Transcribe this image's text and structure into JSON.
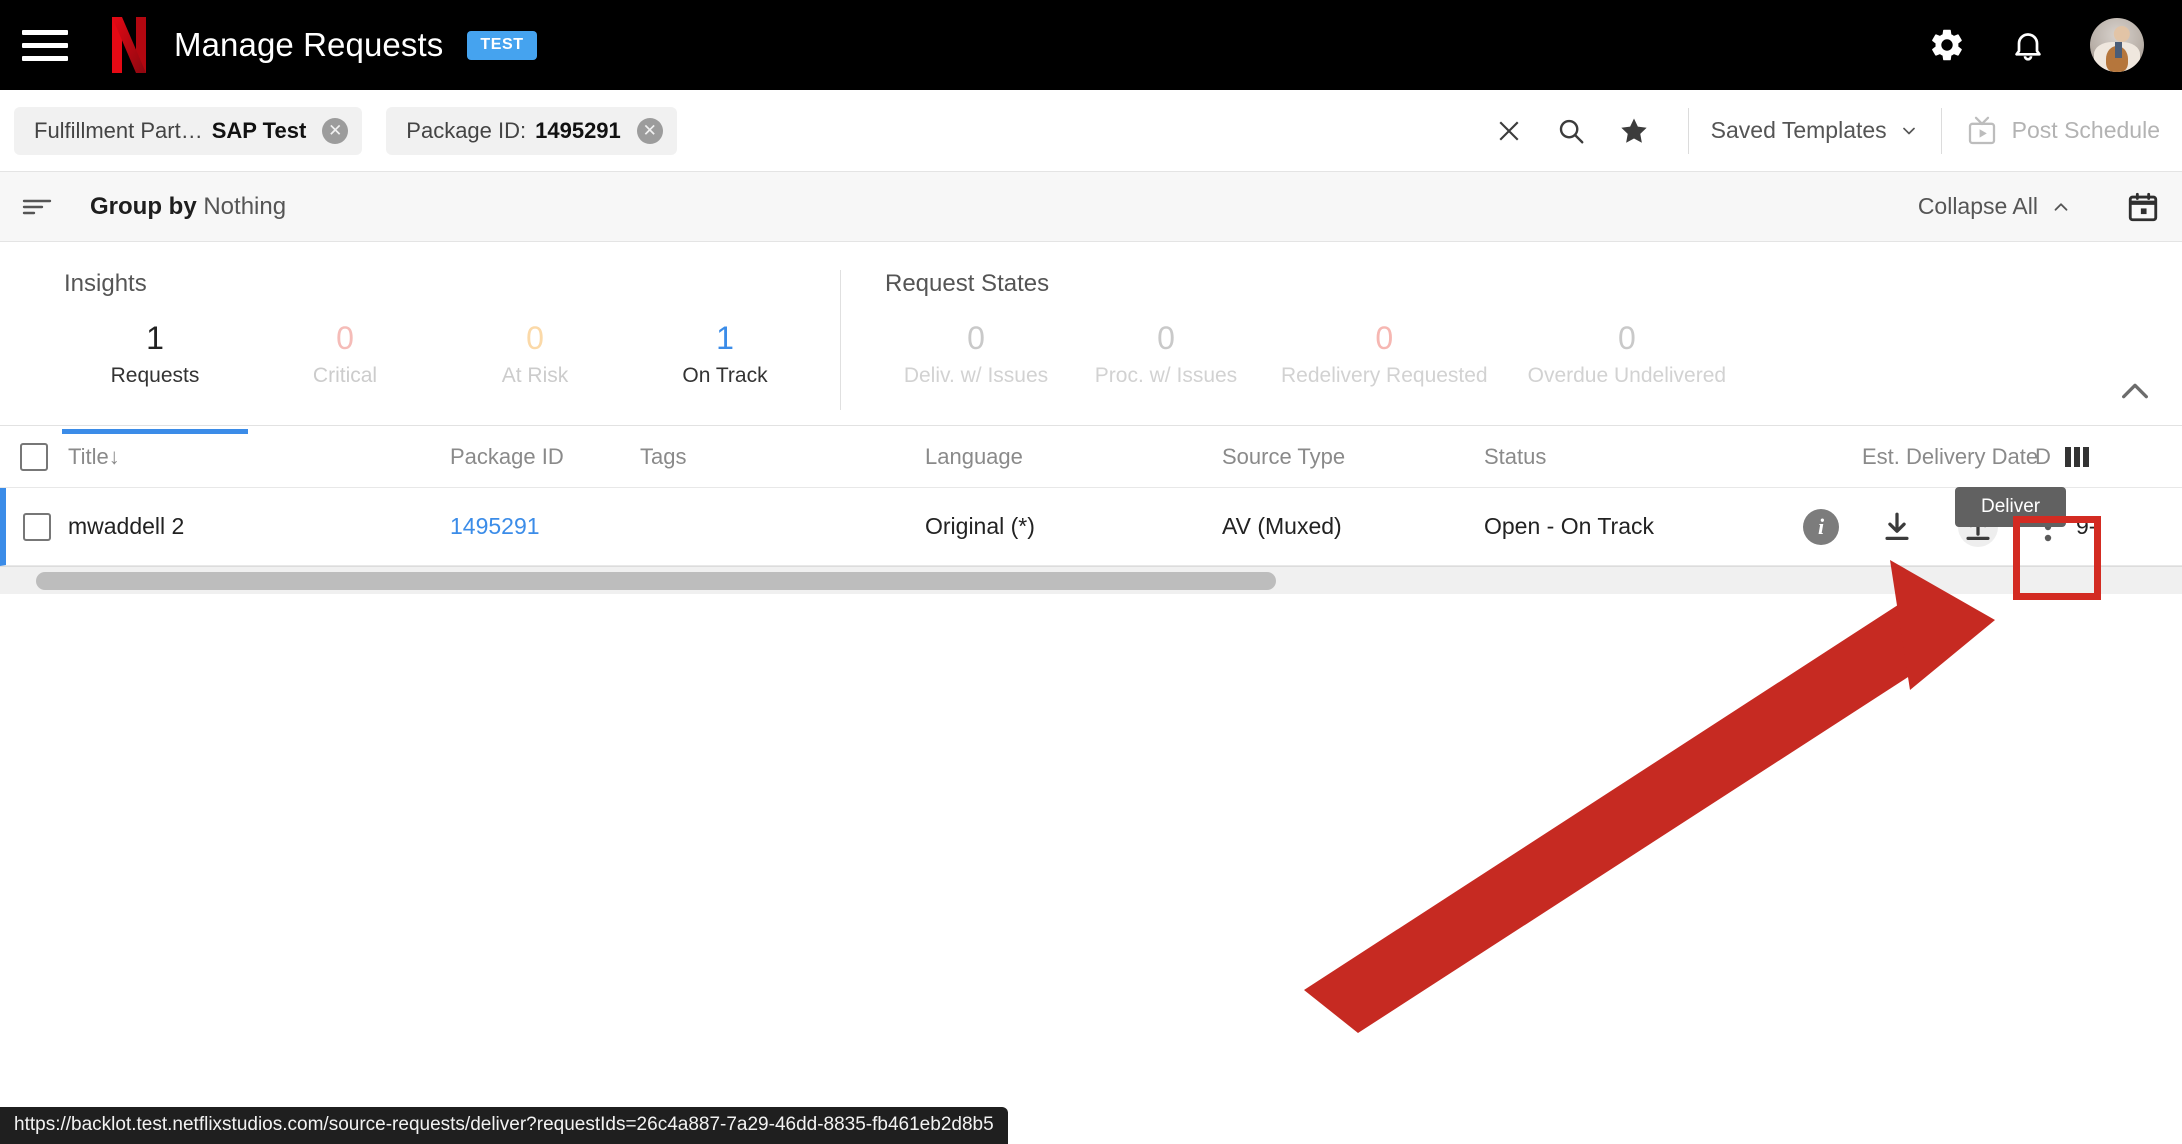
{
  "topnav": {
    "menu_icon": "hamburger-icon",
    "brand_icon": "netflix-n-logo",
    "title": "Manage Requests",
    "env_badge": "TEST",
    "settings_icon": "gear-icon",
    "notifications_icon": "bell-icon",
    "avatar_alt": "user-avatar"
  },
  "filterbar": {
    "chips": [
      {
        "label": "Fulfillment Part…",
        "value": "SAP Test",
        "remove_icon": "close-circle-icon"
      },
      {
        "label": "Package ID:",
        "value": "1495291",
        "remove_icon": "close-circle-icon"
      }
    ],
    "clear_icon": "close-icon",
    "search_icon": "search-icon",
    "favorite_icon": "star-icon",
    "saved_templates_label": "Saved Templates",
    "saved_templates_caret": "chevron-down-icon",
    "post_schedule_icon": "tv-play-icon",
    "post_schedule_label": "Post Schedule"
  },
  "groupbar": {
    "sort_icon": "group-lines-icon",
    "group_by_label": "Group by",
    "group_by_value": "Nothing",
    "collapse_all_label": "Collapse All",
    "collapse_all_caret": "chevron-up-icon",
    "calendar_icon": "calendar-icon"
  },
  "insights": {
    "help_icon": "help-circle-icon",
    "collapse_icon": "chevron-up-icon",
    "groups": [
      {
        "title": "Insights",
        "stats": [
          {
            "value": "1",
            "label": "Requests",
            "value_color": "#222222",
            "label_color": "#333333",
            "active": true
          },
          {
            "value": "0",
            "label": "Critical",
            "value_color": "#f5bcb8",
            "label_color": "#cccccc",
            "active": false
          },
          {
            "value": "0",
            "label": "At Risk",
            "value_color": "#fbd9a8",
            "label_color": "#cccccc",
            "active": false
          },
          {
            "value": "1",
            "label": "On Track",
            "value_color": "#3b8ce8",
            "label_color": "#333333",
            "active": false
          }
        ]
      },
      {
        "title": "Request States",
        "stats": [
          {
            "value": "0",
            "label": "Deliv. w/ Issues",
            "value_color": "#c9c9c9",
            "label_color": "#d2d2d2",
            "active": false
          },
          {
            "value": "0",
            "label": "Proc. w/ Issues",
            "value_color": "#c9c9c9",
            "label_color": "#d2d2d2",
            "active": false
          },
          {
            "value": "0",
            "label": "Redelivery Requested",
            "value_color": "#f6b7b2",
            "label_color": "#d2d2d2",
            "active": false
          },
          {
            "value": "0",
            "label": "Overdue Undelivered",
            "value_color": "#c9c9c9",
            "label_color": "#d2d2d2",
            "active": false
          }
        ]
      }
    ]
  },
  "table": {
    "select_all_icon": "checkbox-unchecked-icon",
    "columns": [
      {
        "label": "Title",
        "sort_indicator": "↓"
      },
      {
        "label": "Package ID"
      },
      {
        "label": "Tags"
      },
      {
        "label": "Language"
      },
      {
        "label": "Source Type"
      },
      {
        "label": "Status"
      },
      {
        "label": "Est. Delivery Date"
      },
      {
        "label": "D"
      }
    ],
    "column_picker_icon": "columns-icon",
    "rows": [
      {
        "checkbox_icon": "checkbox-unchecked-icon",
        "title": "mwaddell 2",
        "package_id": "1495291",
        "tags": "",
        "language": "Original (*)",
        "source_type": "AV (Muxed)",
        "status": "Open - On Track",
        "info_icon": "info-circle-icon",
        "download_icon": "download-icon",
        "deliver_icon": "upload-icon",
        "more_icon": "more-vertical-icon",
        "est_delivery_date": "9-"
      }
    ],
    "deliver_tooltip": "Deliver",
    "scrollbar": "horizontal-scrollbar"
  },
  "annotation": {
    "arrow_color": "#c62a22",
    "highlight_color": "#d32b22"
  },
  "statusbar": {
    "url": "https://backlot.test.netflixstudios.com/source-requests/deliver?requestIds=26c4a887-7a29-46dd-8835-fb461eb2d8b5"
  }
}
